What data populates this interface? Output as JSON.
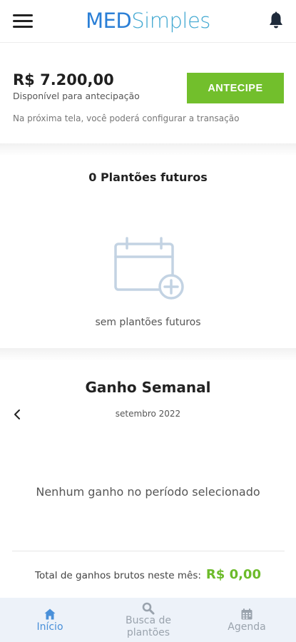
{
  "header": {
    "logo_part1": "MED",
    "logo_part2": "Simples",
    "brand_color": "#2b7fd6",
    "menu_icon": "hamburger-menu-icon",
    "notification_icon": "bell-icon"
  },
  "antecipacao": {
    "amount": "R$ 7.200,00",
    "subtitle": "Disponível para antecipação",
    "button_label": "ANTECIPE",
    "button_color": "#72bf2c",
    "note": "Na próxima tela, você poderá configurar a transação"
  },
  "plantoes_futuros": {
    "title": "0 Plantões futuros",
    "empty_icon": "calendar-add-icon",
    "empty_text": "sem plantões futuros"
  },
  "ganho_semanal": {
    "title": "Ganho Semanal",
    "prev_icon": "chevron-left-icon",
    "month": "setembro 2022",
    "empty_text": "Nenhum ganho no período selecionado",
    "total_label": "Total de ganhos brutos neste mês:",
    "total_value": "R$ 0,00",
    "total_color": "#6cbb2a"
  },
  "bottom_nav": {
    "items": [
      {
        "label": "Início",
        "icon": "home-icon",
        "active": true
      },
      {
        "label": "Busca de plantões",
        "icon": "search-icon",
        "active": false
      },
      {
        "label": "Agenda",
        "icon": "calendar-icon",
        "active": false
      }
    ],
    "active_color": "#4a90d9",
    "inactive_color": "#9aa3ad"
  }
}
